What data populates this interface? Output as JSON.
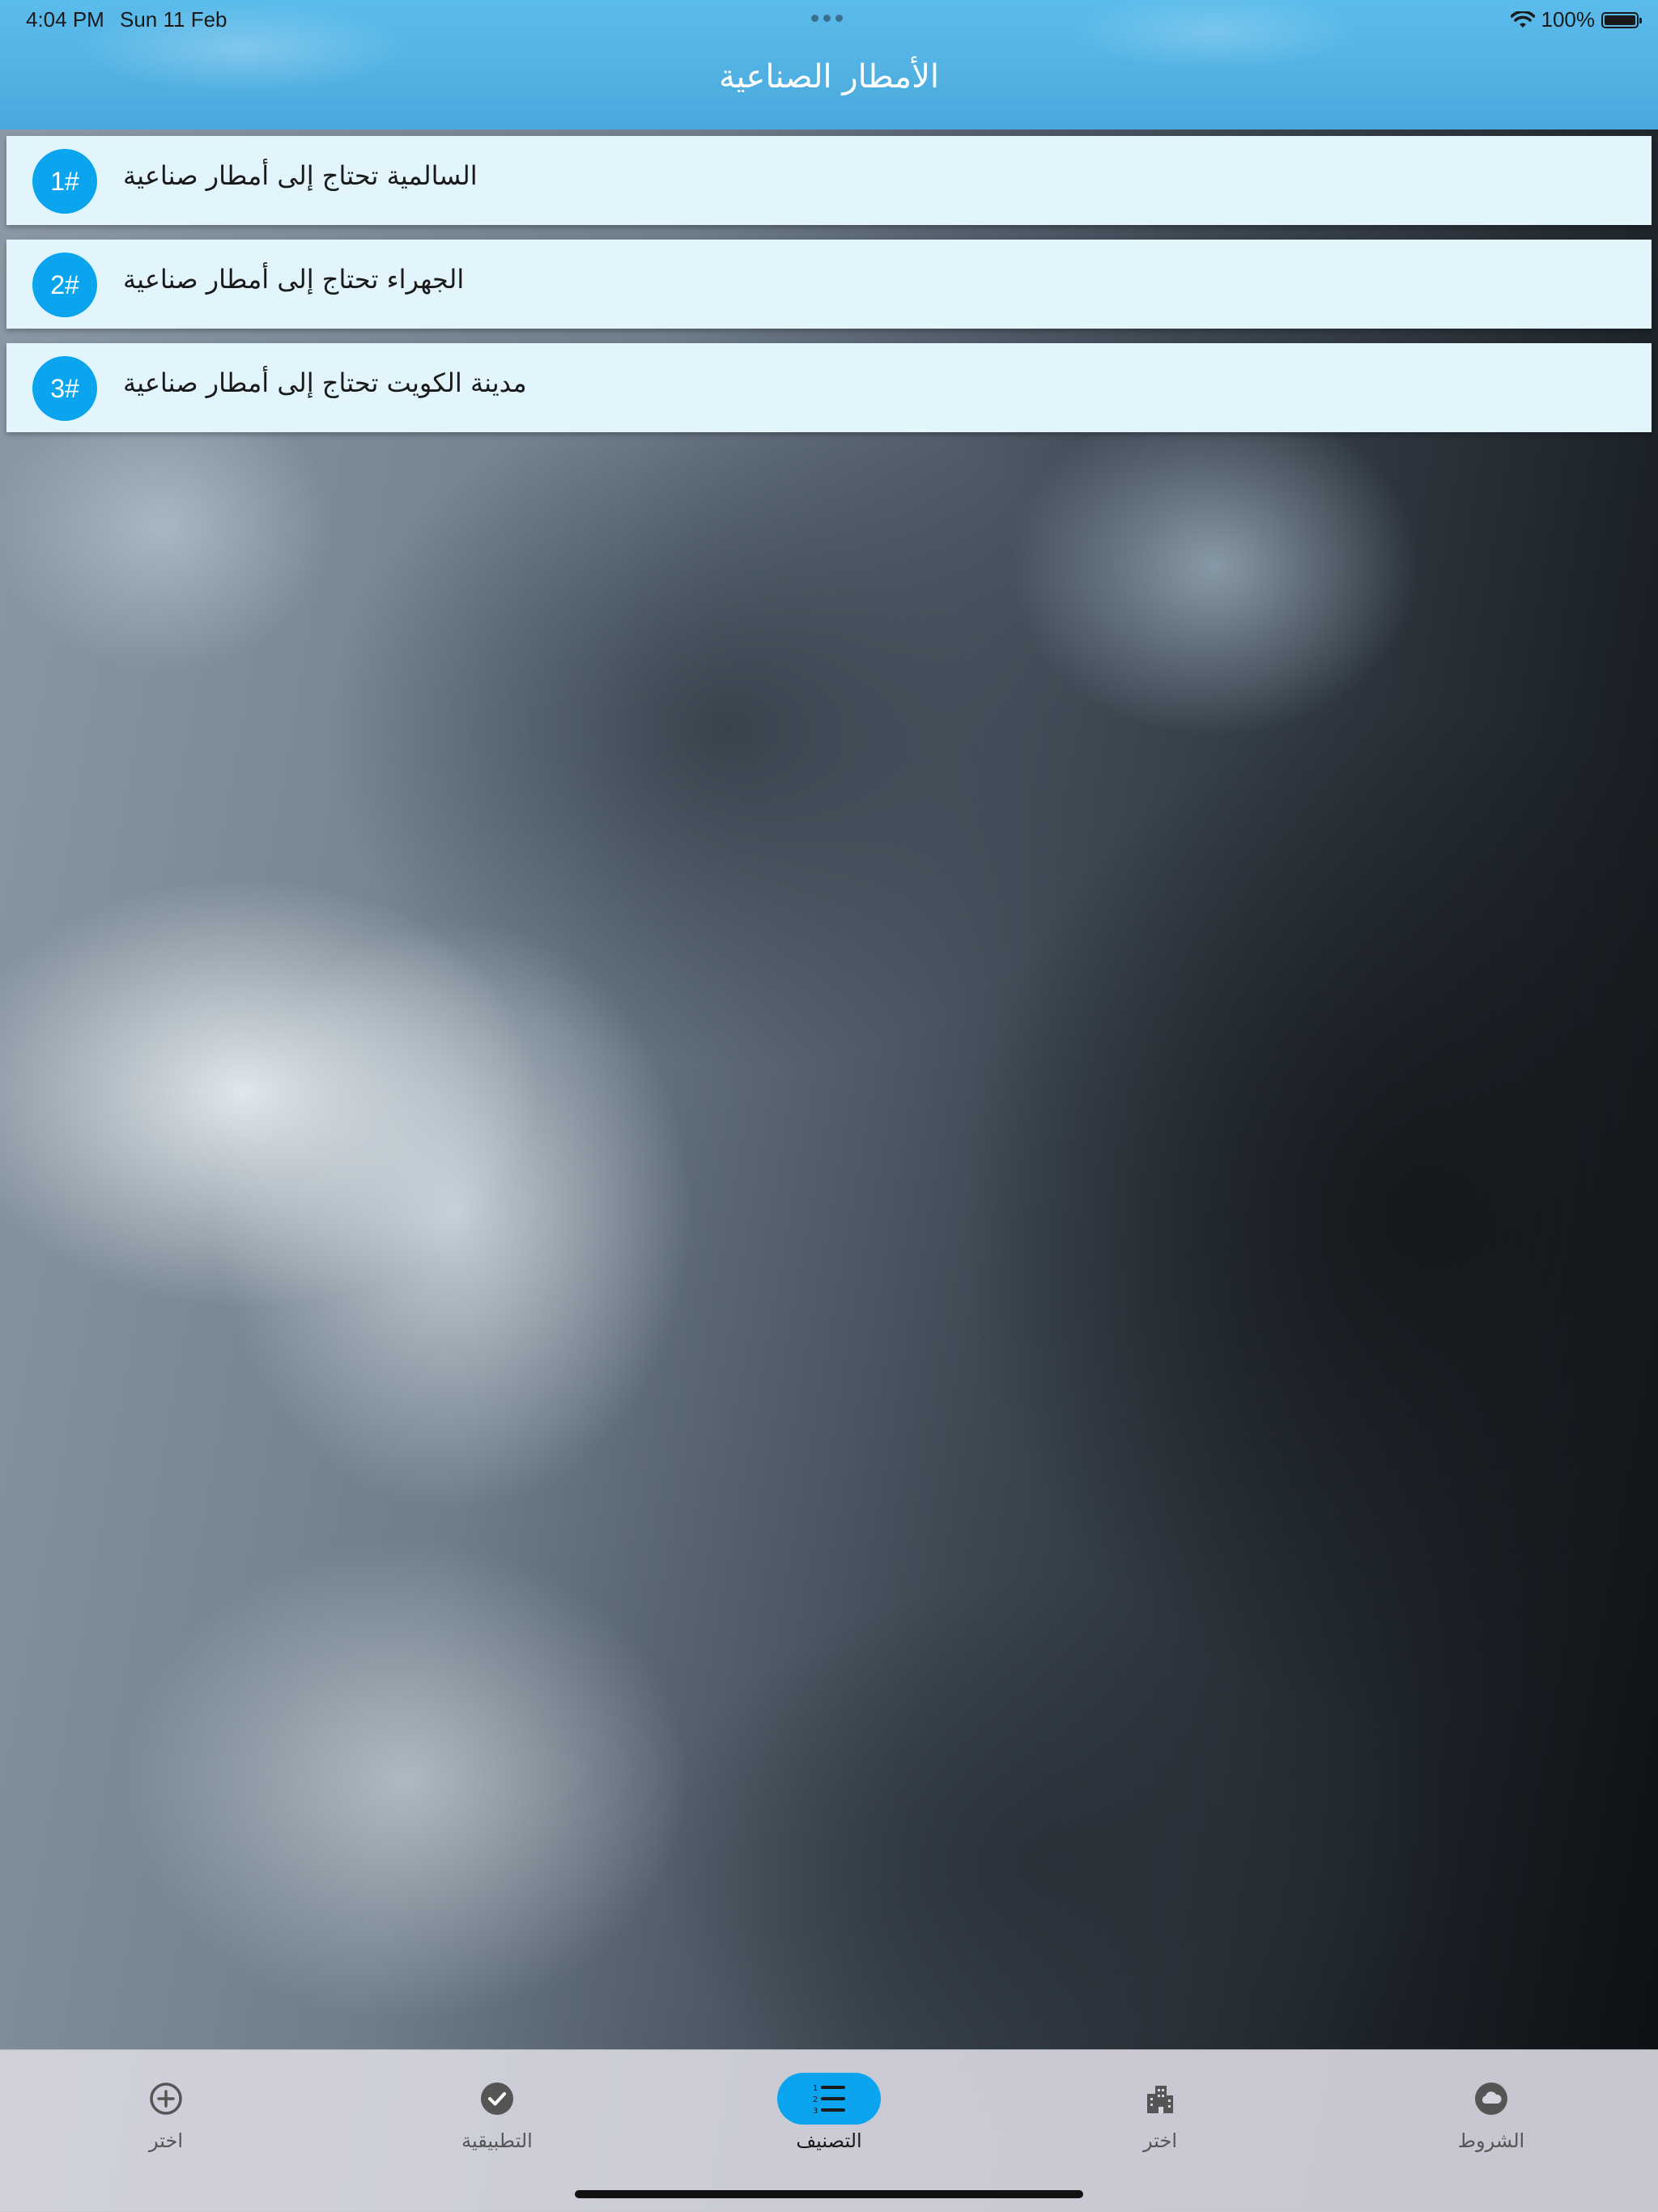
{
  "status_bar": {
    "time": "4:04 PM",
    "date": "Sun 11 Feb",
    "battery": "100%"
  },
  "header": {
    "title": "الأمطار الصناعية"
  },
  "list": {
    "items": [
      {
        "badge": "1#",
        "text": "السالمية تحتاج إلى أمطار صناعية"
      },
      {
        "badge": "2#",
        "text": "الجهراء تحتاج إلى أمطار صناعية"
      },
      {
        "badge": "3#",
        "text": "مدينة الكويت تحتاج إلى أمطار صناعية"
      }
    ]
  },
  "tabs": [
    {
      "label": "اختر",
      "icon": "plus-circle-icon",
      "active": false
    },
    {
      "label": "التطبيقية",
      "icon": "check-circle-icon",
      "active": false
    },
    {
      "label": "التصنيف",
      "icon": "numbered-list-icon",
      "active": true
    },
    {
      "label": "اختر",
      "icon": "building-icon",
      "active": false
    },
    {
      "label": "الشروط",
      "icon": "cloud-circle-icon",
      "active": false
    }
  ],
  "colors": {
    "header": "#4aa9dc",
    "accent": "#0aa5ee",
    "list_item_bg": "#e2f5fd"
  }
}
